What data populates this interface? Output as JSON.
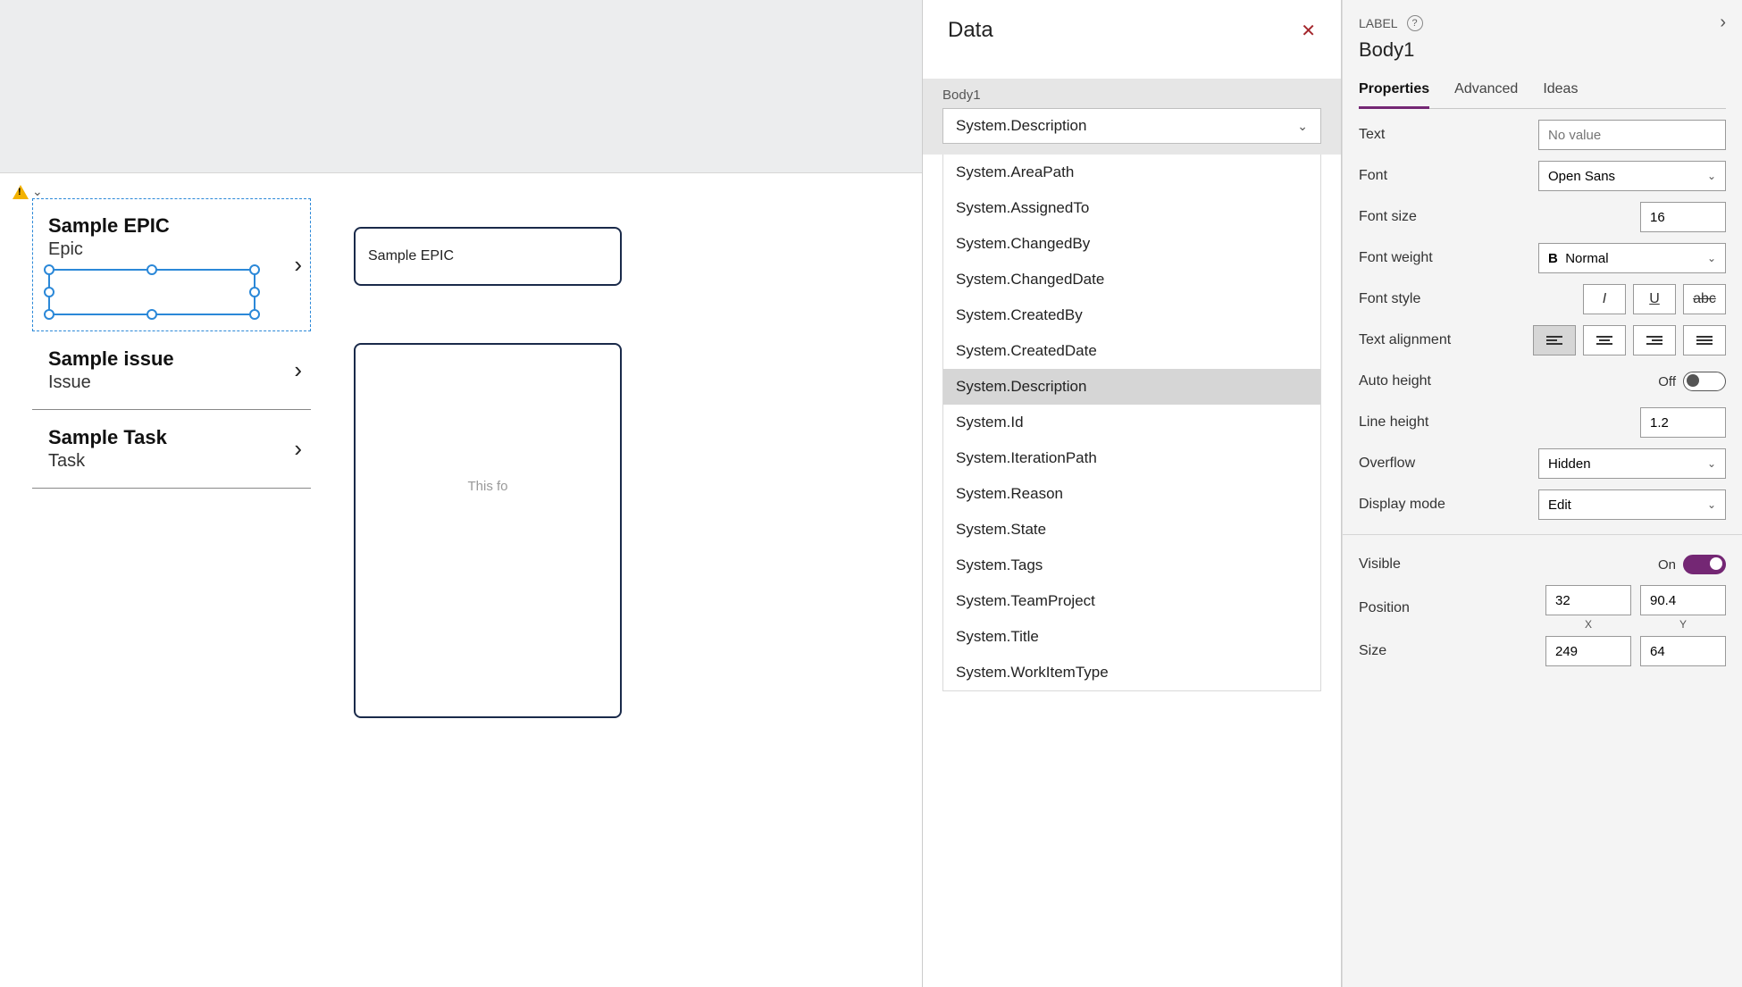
{
  "canvas": {
    "items": [
      {
        "title": "Sample EPIC",
        "subtitle": "Epic",
        "selected": true
      },
      {
        "title": "Sample issue",
        "subtitle": "Issue",
        "selected": false
      },
      {
        "title": "Sample Task",
        "subtitle": "Task",
        "selected": false
      }
    ],
    "detail_title": "Sample EPIC",
    "detail_placeholder": "This fo"
  },
  "data_pane": {
    "title": "Data",
    "section_label": "Body1",
    "selected_value": "System.Description",
    "highlighted_option": "System.Description",
    "options": [
      "System.AreaPath",
      "System.AssignedTo",
      "System.ChangedBy",
      "System.ChangedDate",
      "System.CreatedBy",
      "System.CreatedDate",
      "System.Description",
      "System.Id",
      "System.IterationPath",
      "System.Reason",
      "System.State",
      "System.Tags",
      "System.TeamProject",
      "System.Title",
      "System.WorkItemType"
    ]
  },
  "prop_pane": {
    "kind_label": "LABEL",
    "object_name": "Body1",
    "tabs": {
      "properties": "Properties",
      "advanced": "Advanced",
      "ideas": "Ideas"
    },
    "active_tab": "properties",
    "props": {
      "text_label": "Text",
      "text_value": "No value",
      "font_label": "Font",
      "font_value": "Open Sans",
      "font_size_label": "Font size",
      "font_size_value": "16",
      "font_weight_label": "Font weight",
      "font_weight_value": "Normal",
      "font_style_label": "Font style",
      "text_align_label": "Text alignment",
      "auto_height_label": "Auto height",
      "auto_height_state": "Off",
      "line_height_label": "Line height",
      "line_height_value": "1.2",
      "overflow_label": "Overflow",
      "overflow_value": "Hidden",
      "display_mode_label": "Display mode",
      "display_mode_value": "Edit",
      "visible_label": "Visible",
      "visible_state": "On",
      "position_label": "Position",
      "pos_x": "32",
      "pos_y": "90.4",
      "pos_x_caption": "X",
      "pos_y_caption": "Y",
      "size_label": "Size",
      "size_w": "249",
      "size_h": "64"
    }
  }
}
